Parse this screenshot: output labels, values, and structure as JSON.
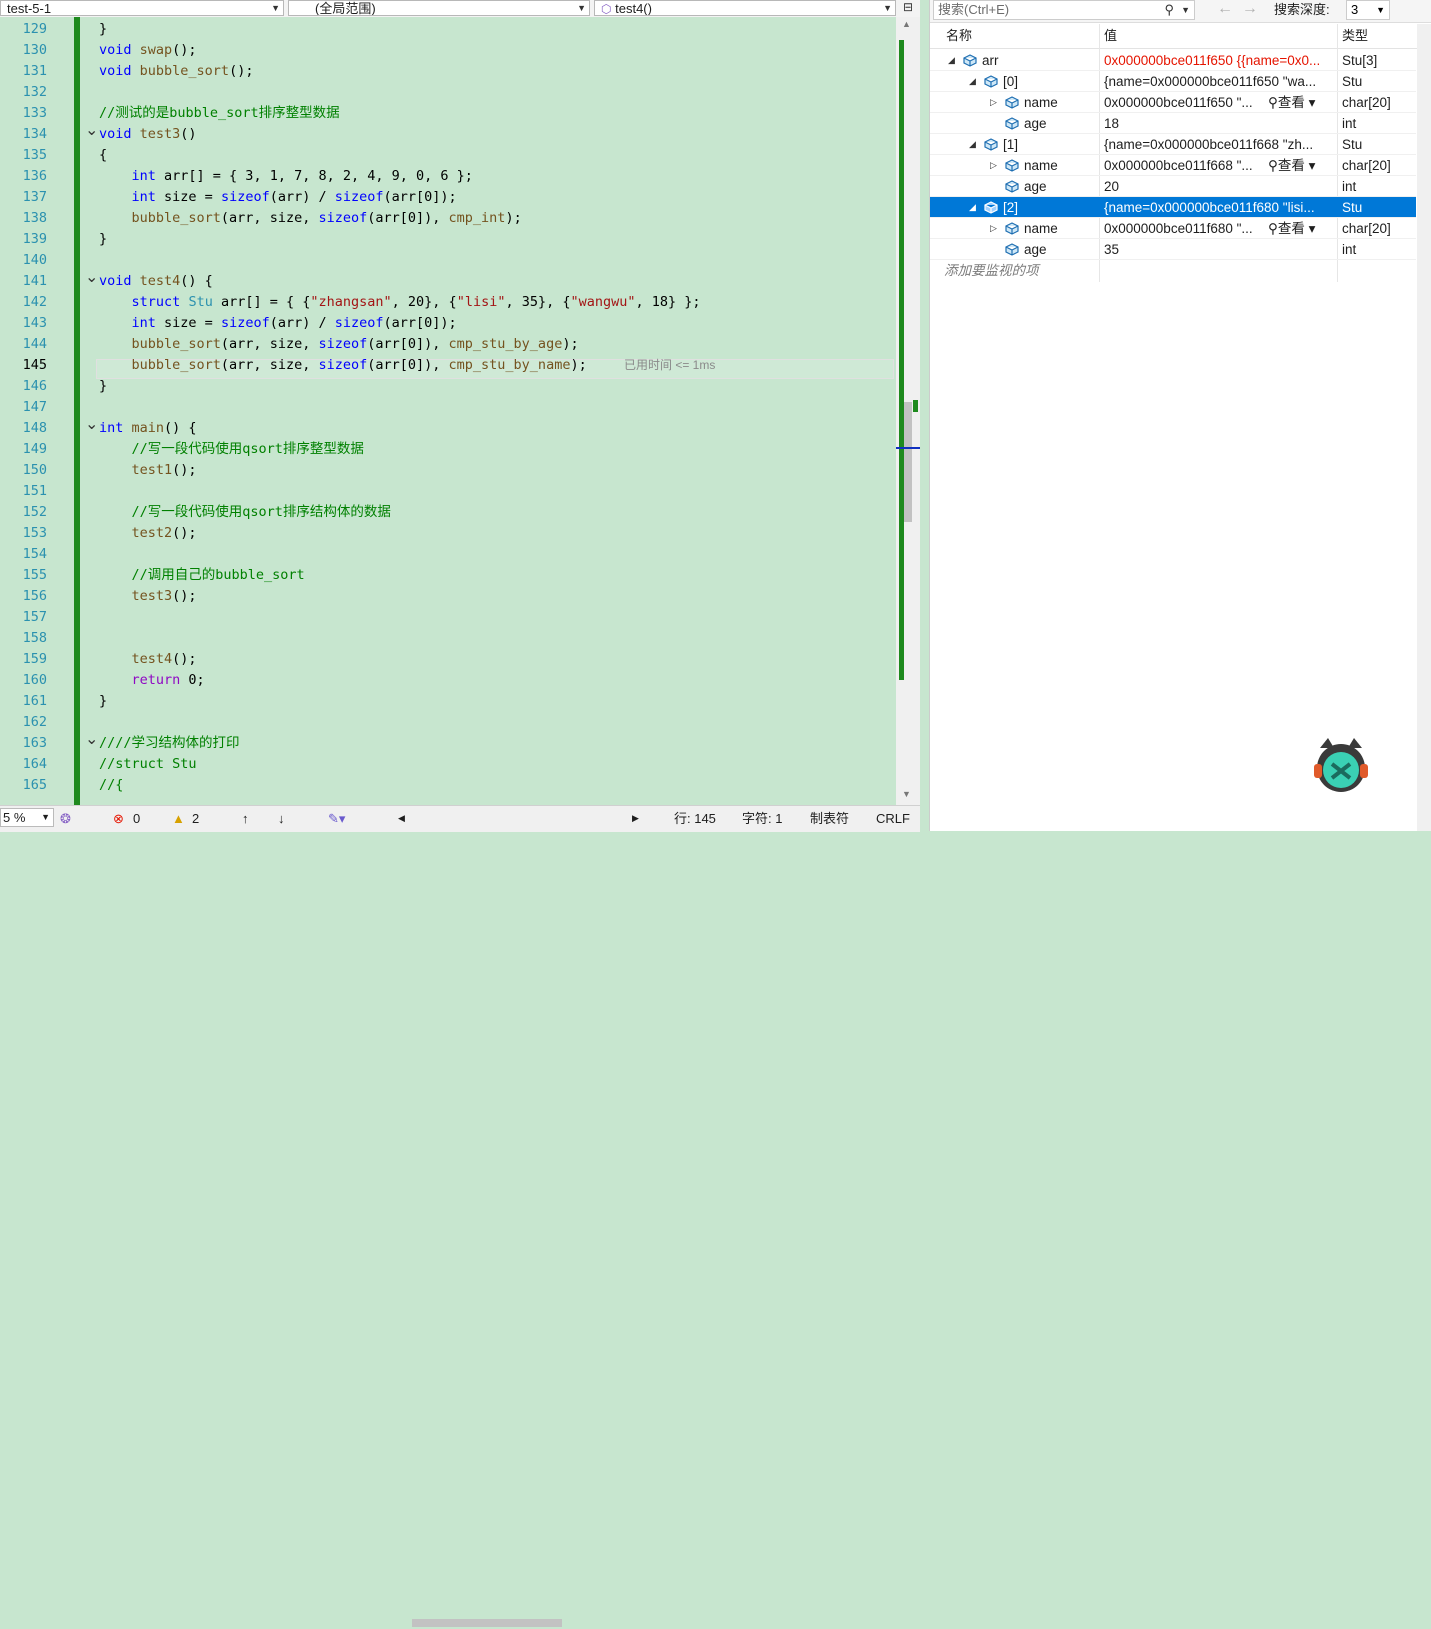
{
  "editor": {
    "project_dropdown": "test-5-1",
    "scope_dropdown": "(全局范围)",
    "function_dropdown": "test4()",
    "current_line": "145",
    "elapsed_hint": "已用时间 <= 1ms",
    "lines": [
      {
        "n": "129",
        "fold": "",
        "html": "}"
      },
      {
        "n": "130",
        "fold": "",
        "html": "<span class=\"kw\">void</span> <span class=\"fn\">swap</span>();"
      },
      {
        "n": "131",
        "fold": "",
        "html": "<span class=\"kw\">void</span> <span class=\"fn\">bubble_sort</span>();"
      },
      {
        "n": "132",
        "fold": "",
        "html": ""
      },
      {
        "n": "133",
        "fold": "",
        "html": "<span class=\"cm\">//测试的是bubble_sort排序整型数据</span>"
      },
      {
        "n": "134",
        "fold": "v",
        "html": "<span class=\"kw\">void</span> <span class=\"fn\">test3</span>()"
      },
      {
        "n": "135",
        "fold": "",
        "html": "{"
      },
      {
        "n": "136",
        "fold": "",
        "html": "    <span class=\"kw\">int</span> arr[] = { 3, 1, 7, 8, 2, 4, 9, 0, 6 };"
      },
      {
        "n": "137",
        "fold": "",
        "html": "    <span class=\"kw\">int</span> size = <span class=\"kw\">sizeof</span>(arr) / <span class=\"kw\">sizeof</span>(arr[0]);"
      },
      {
        "n": "138",
        "fold": "",
        "html": "    <span class=\"fn\">bubble_sort</span>(arr, size, <span class=\"kw\">sizeof</span>(arr[0]), <span class=\"fn\">cmp_int</span>);"
      },
      {
        "n": "139",
        "fold": "",
        "html": "}"
      },
      {
        "n": "140",
        "fold": "",
        "html": ""
      },
      {
        "n": "141",
        "fold": "v",
        "html": "<span class=\"kw\">void</span> <span class=\"fn\">test4</span>() {"
      },
      {
        "n": "142",
        "fold": "",
        "html": "    <span class=\"kw\">struct</span> <span class=\"ty\">Stu</span> arr[] = { {<span class=\"str\">\"zhangsan\"</span>, 20}, {<span class=\"str\">\"lisi\"</span>, 35}, {<span class=\"str\">\"wangwu\"</span>, 18} };"
      },
      {
        "n": "143",
        "fold": "",
        "html": "    <span class=\"kw\">int</span> size = <span class=\"kw\">sizeof</span>(arr) / <span class=\"kw\">sizeof</span>(arr[0]);"
      },
      {
        "n": "144",
        "fold": "",
        "html": "    <span class=\"fn\">bubble_sort</span>(arr, size, <span class=\"kw\">sizeof</span>(arr[0]), <span class=\"fn\">cmp_stu_by_age</span>);"
      },
      {
        "n": "145",
        "fold": "",
        "html": "    <span class=\"fn\">bubble_sort</span>(arr, size, <span class=\"kw\">sizeof</span>(arr[0]), <span class=\"fn\">cmp_stu_by_name</span>);"
      },
      {
        "n": "146",
        "fold": "",
        "html": "}"
      },
      {
        "n": "147",
        "fold": "",
        "html": ""
      },
      {
        "n": "148",
        "fold": "v",
        "html": "<span class=\"kw\">int</span> <span class=\"fn\">main</span>() {"
      },
      {
        "n": "149",
        "fold": "",
        "html": "    <span class=\"cm\">//写一段代码使用qsort排序整型数据</span>"
      },
      {
        "n": "150",
        "fold": "",
        "html": "    <span class=\"fn\">test1</span>();"
      },
      {
        "n": "151",
        "fold": "",
        "html": ""
      },
      {
        "n": "152",
        "fold": "",
        "html": "    <span class=\"cm\">//写一段代码使用qsort排序结构体的数据</span>"
      },
      {
        "n": "153",
        "fold": "",
        "html": "    <span class=\"fn\">test2</span>();"
      },
      {
        "n": "154",
        "fold": "",
        "html": ""
      },
      {
        "n": "155",
        "fold": "",
        "html": "    <span class=\"cm\">//调用自己的bubble_sort</span>"
      },
      {
        "n": "156",
        "fold": "",
        "html": "    <span class=\"fn\">test3</span>();"
      },
      {
        "n": "157",
        "fold": "",
        "html": ""
      },
      {
        "n": "158",
        "fold": "",
        "html": ""
      },
      {
        "n": "159",
        "fold": "",
        "html": "    <span class=\"fn\">test4</span>();"
      },
      {
        "n": "160",
        "fold": "",
        "html": "    <span class=\"ctl\">return</span> 0;"
      },
      {
        "n": "161",
        "fold": "",
        "html": "}"
      },
      {
        "n": "162",
        "fold": "",
        "html": ""
      },
      {
        "n": "163",
        "fold": "v",
        "html": "<span class=\"cm\">////学习结构体的打印</span>"
      },
      {
        "n": "164",
        "fold": "",
        "html": "<span class=\"cm\">//struct Stu</span>"
      },
      {
        "n": "165",
        "fold": "",
        "html": "<span class=\"cm\">//{</span>"
      }
    ]
  },
  "status": {
    "zoom": "5 %",
    "errors": "0",
    "warnings": "2",
    "line": "行: 145",
    "char": "字符: 1",
    "tabs": "制表符",
    "eol": "CRLF"
  },
  "watch": {
    "search_placeholder": "搜索(Ctrl+E)",
    "depth_label": "搜索深度:",
    "depth_value": "3",
    "col_name": "名称",
    "col_value": "值",
    "col_type": "类型",
    "add_item": "添加要监视的项",
    "viewer_label": "查看",
    "rows": [
      {
        "level": 0,
        "exp": "◢",
        "name": "arr",
        "value": "0x000000bce011f650 {{name=0x0...",
        "type": "Stu[3]",
        "red": true,
        "viewer": false,
        "sel": false
      },
      {
        "level": 1,
        "exp": "◢",
        "name": "[0]",
        "value": "{name=0x000000bce011f650 \"wa...",
        "type": "Stu",
        "red": false,
        "viewer": false,
        "sel": false
      },
      {
        "level": 2,
        "exp": "▷",
        "name": "name",
        "value": "0x000000bce011f650 \"...",
        "type": "char[20]",
        "red": false,
        "viewer": true,
        "sel": false
      },
      {
        "level": 2,
        "exp": "",
        "name": "age",
        "value": "18",
        "type": "int",
        "red": false,
        "viewer": false,
        "sel": false
      },
      {
        "level": 1,
        "exp": "◢",
        "name": "[1]",
        "value": "{name=0x000000bce011f668 \"zh...",
        "type": "Stu",
        "red": false,
        "viewer": false,
        "sel": false
      },
      {
        "level": 2,
        "exp": "▷",
        "name": "name",
        "value": "0x000000bce011f668 \"...",
        "type": "char[20]",
        "red": false,
        "viewer": true,
        "sel": false
      },
      {
        "level": 2,
        "exp": "",
        "name": "age",
        "value": "20",
        "type": "int",
        "red": false,
        "viewer": false,
        "sel": false
      },
      {
        "level": 1,
        "exp": "◢",
        "name": "[2]",
        "value": "{name=0x000000bce011f680 \"lisi...",
        "type": "Stu",
        "red": false,
        "viewer": false,
        "sel": true
      },
      {
        "level": 2,
        "exp": "▷",
        "name": "name",
        "value": "0x000000bce011f680 \"...",
        "type": "char[20]",
        "red": false,
        "viewer": true,
        "sel": false
      },
      {
        "level": 2,
        "exp": "",
        "name": "age",
        "value": "35",
        "type": "int",
        "red": false,
        "viewer": false,
        "sel": false
      }
    ]
  },
  "colors": {
    "editor_bg": "#c7e6cf",
    "change_bar": "#1e8a1e",
    "selection": "#0078d7",
    "error_value": "#e51400"
  }
}
